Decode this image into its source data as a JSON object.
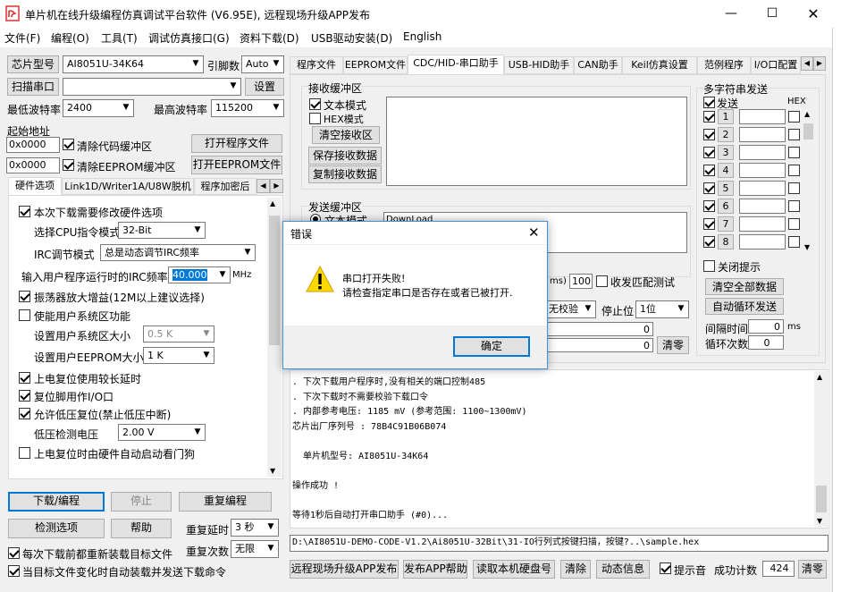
{
  "title": "单片机在线升级编程仿真调试平台软件 (V6.95E), 远程现场升级APP发布",
  "menu": [
    "文件(F)",
    "编程(O)",
    "工具(T)",
    "调试仿真接口(G)",
    "资料下载(D)",
    "USB驱动安装(D)",
    "English"
  ],
  "left": {
    "chip_btn": "芯片型号",
    "chip_value": "AI8051U-34K64",
    "lead_label": "引脚数",
    "lead_value": "Auto",
    "scan_btn": "扫描串口",
    "setting_btn": "设置",
    "min_baud_label": "最低波特率",
    "min_baud": "2400",
    "max_baud_label": "最高波特率",
    "max_baud": "115200",
    "start_addr_label": "起始地址",
    "addr1": "0x0000",
    "clear_code": "清除代码缓冲区",
    "open_prog": "打开程序文件",
    "addr2": "0x0000",
    "clear_eeprom": "清除EEPROM缓冲区",
    "open_eeprom": "打开EEPROM文件",
    "tabs": [
      "硬件选项",
      "Link1D/Writer1A/U8W脱机",
      "程序加密后"
    ],
    "hw": {
      "opt1": "本次下载需要修改硬件选项",
      "cpu_label": "选择CPU指令模式",
      "cpu_value": "32-Bit",
      "irc_label": "IRC调节模式",
      "irc_value": "总是动态调节IRC频率",
      "freq_label": "输入用户程序运行时的IRC频率",
      "freq_value": "40.000",
      "freq_unit": "MHz",
      "osc": "振荡器放大增益(12M以上建议选择)",
      "sys_area": "使能用户系统区功能",
      "sys_size_label": "设置用户系统区大小",
      "sys_size": "0.5 K",
      "eeprom_size_label": "设置用户EEPROM大小",
      "eeprom_size": "1   K",
      "por_delay": "上电复位使用较长延时",
      "reset_io": "复位脚用作I/O口",
      "lvr": "允许低压复位(禁止低压中断)",
      "lvd_label": "低压检测电压",
      "lvd_value": "2.00 V",
      "wdt": "上电复位时由硬件自动启动看门狗"
    },
    "download_btn": "下载/编程",
    "stop_btn": "停止",
    "reprog_btn": "重复编程",
    "check_btn": "检测选项",
    "help_btn": "帮助",
    "delay_label": "重复延时",
    "delay_value": "3 秒",
    "count_label": "重复次数",
    "count_value": "无限",
    "reload": "每次下载前都重新装载目标文件",
    "auto_load": "当目标文件变化时自动装载并发送下载命令"
  },
  "right": {
    "tabs": [
      "程序文件",
      "EEPROM文件",
      "CDC/HID-串口助手",
      "USB-HID助手",
      "CAN助手",
      "Keil仿真设置",
      "范例程序",
      "I/O口配置"
    ],
    "recv_label": "接收缓冲区",
    "text_mode": "文本模式",
    "hex_mode": "HEX模式",
    "clear_recv": "清空接收区",
    "save_recv": "保存接收数据",
    "copy_recv": "复制接收数据",
    "send_label": "发送缓冲区",
    "send_text_mode": "文本模式",
    "send_content": "DownLoad",
    "ms_value": "100",
    "ms_unit": "ms)",
    "match": "收发匹配测试",
    "check_value": "无校验",
    "stop_label": "停止位",
    "stop_value": "1位",
    "rx_count": "0",
    "tx_count": "0",
    "clear_count": "清零",
    "multi_label": "多字符串发送",
    "send_col": "发送",
    "hex_col": "HEX",
    "rows": [
      "1",
      "2",
      "3",
      "4",
      "5",
      "6",
      "7",
      "8"
    ],
    "close_tip": "关闭提示",
    "clear_all": "清空全部数据",
    "auto_loop": "自动循环发送",
    "interval_label": "间隔时间",
    "interval_value": "0",
    "interval_unit": "ms",
    "loop_label": "循环次数",
    "loop_value": "0"
  },
  "log": [
    ". 下次下载用户程序时,没有相关的端口控制485",
    ". 下次下载时不需要校验下载口令",
    ". 内部参考电压: 1185 mV (参考范围: 1100~1300mV)",
    "芯片出厂序列号 : 78B4C91B06B074",
    "",
    "  单片机型号: AI8051U-34K64",
    "",
    "操作成功 !",
    "",
    "等待1秒后自动打开串口助手 (#0)..."
  ],
  "path": "D:\\AI8051U-DEMO-CODE-V1.2\\Ai8051U-32Bit\\31-IO行列式按键扫描，按键?..\\sample.hex",
  "bottom": {
    "remote": "远程现场升级APP发布",
    "help": "发布APP帮助",
    "read_disk": "读取本机硬盘号",
    "clear": "清除",
    "anim": "动态信息",
    "sound": "提示音",
    "success_label": "成功计数",
    "success_value": "424",
    "clear2": "清零"
  },
  "dialog": {
    "title": "错误",
    "line1": "串口打开失败!",
    "line2": "请检查指定串口是否存在或者已被打开.",
    "ok": "确定"
  }
}
